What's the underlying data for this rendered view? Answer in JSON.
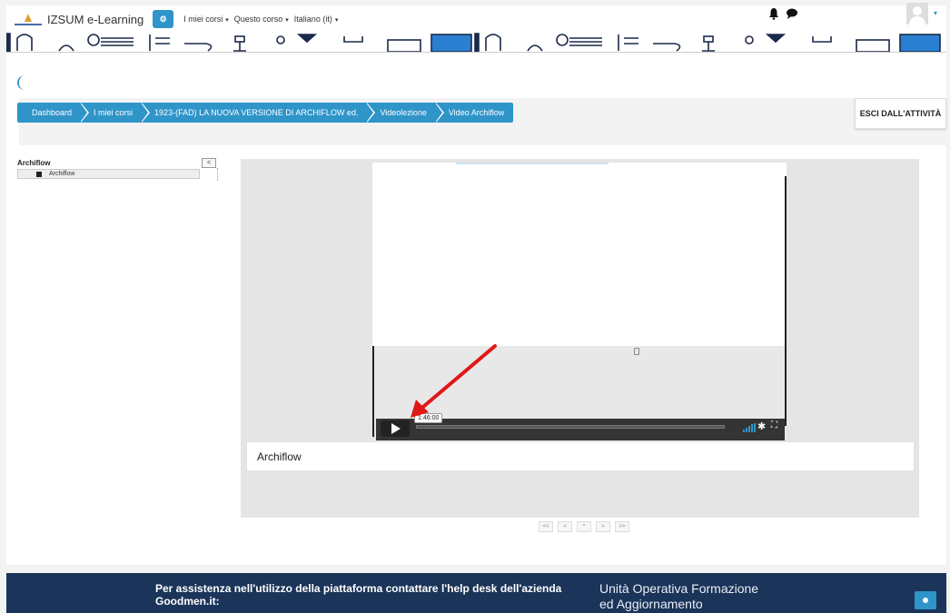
{
  "navbar": {
    "brand": "IZSUM e-Learning",
    "menu_items": [
      {
        "label": "I miei corsi",
        "has_caret": true
      },
      {
        "label": "Questo corso",
        "has_caret": true
      },
      {
        "label": "Italiano (it)",
        "has_caret": true
      }
    ],
    "icons": [
      "bell-icon",
      "chat-icon"
    ],
    "caret": "▾"
  },
  "breadcrumb": {
    "items": [
      "Dashboard",
      "I miei corsi",
      "1923-(FAD) LA NUOVA VERSIONE DI ARCHIFLOW ed.",
      "Videolezione",
      "Video Archiflow"
    ]
  },
  "header": {
    "exit_label": "ESCI DALL'ATTIVITÀ"
  },
  "toc": {
    "title": "Archiflow",
    "collapse_label": "<",
    "items": [
      {
        "label": "Archiflow"
      }
    ]
  },
  "player": {
    "time_tooltip": "1:46:00",
    "progress": 0.0,
    "caption": "Archiflow"
  },
  "pager": {
    "buttons": [
      "<<",
      "<",
      "^",
      ">",
      ">>"
    ]
  },
  "footer": {
    "help_text": "Per assistenza nell'utilizzo della piattaforma contattare l'help desk dell'azienda Goodmen.it:",
    "unit_line1": "Unità Operativa Formazione",
    "unit_line2": "ed Aggiornamento"
  },
  "colors": {
    "accent": "#2f95c9",
    "footer_bg": "#1b3459",
    "arrow": "#e01818"
  }
}
